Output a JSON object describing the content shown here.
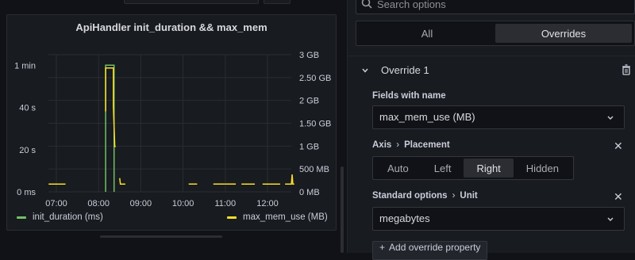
{
  "panel": {
    "title": "ApiHandler init_duration && max_mem",
    "legend": [
      {
        "label": "init_duration (ms)",
        "color": "#73bf69"
      },
      {
        "label": "max_mem_use (MB)",
        "color": "#fade2a"
      }
    ]
  },
  "chart_data": {
    "type": "line",
    "title": "ApiHandler init_duration && max_mem",
    "x_ticks": [
      "07:00",
      "08:00",
      "09:00",
      "10:00",
      "11:00",
      "12:00"
    ],
    "y_left_ticks": [
      "0 ms",
      "20 s",
      "40 s",
      "1 min"
    ],
    "y_left_range_seconds": [
      0,
      65
    ],
    "y_right_ticks": [
      "0 MB",
      "500 MB",
      "1 GB",
      "1.50 GB",
      "2 GB",
      "2.50 GB",
      "3 GB"
    ],
    "y_right_range_MB": [
      0,
      3000
    ],
    "grid": true,
    "legend_placement": "bottom",
    "series": [
      {
        "name": "init_duration (ms)",
        "axis": "left",
        "color": "#73bf69",
        "points": [
          [
            "08:10",
            0
          ],
          [
            "08:10",
            60
          ],
          [
            "08:22",
            60
          ],
          [
            "08:22",
            0
          ]
        ]
      },
      {
        "name": "max_mem_use (MB)",
        "axis": "right",
        "color": "#fade2a",
        "segments": [
          [
            [
              "06:49",
              170
            ],
            [
              "07:13",
              170
            ]
          ],
          [
            [
              "08:10",
              1760
            ],
            [
              "08:10",
              2710
            ],
            [
              "08:21",
              2710
            ],
            [
              "08:21",
              1880
            ],
            [
              "08:23",
              1000
            ],
            [
              "08:24",
              980
            ]
          ],
          [
            [
              "08:30",
              300
            ],
            [
              "08:31",
              170
            ],
            [
              "08:38",
              170
            ]
          ],
          [
            [
              "10:08",
              170
            ],
            [
              "10:20",
              170
            ]
          ],
          [
            [
              "10:43",
              170
            ],
            [
              "11:00",
              170
            ]
          ],
          [
            [
              "11:00",
              170
            ],
            [
              "11:15",
              170
            ]
          ],
          [
            [
              "11:23",
              170
            ],
            [
              "11:42",
              170
            ]
          ],
          [
            [
              "11:53",
              170
            ],
            [
              "12:18",
              170
            ]
          ],
          [
            [
              "12:25",
              170
            ],
            [
              "12:34",
              170
            ],
            [
              "12:35",
              380
            ],
            [
              "12:36",
              170
            ],
            [
              "12:38",
              170
            ]
          ]
        ]
      }
    ]
  },
  "options": {
    "search_placeholder": "Search options",
    "tabs": [
      {
        "label": "All",
        "active": false
      },
      {
        "label": "Overrides",
        "active": true
      }
    ],
    "override": {
      "title": "Override 1",
      "fields_label": "Fields with name",
      "fields_value": "max_mem_use (MB)",
      "axis_label_a": "Axis",
      "axis_label_b": "Placement",
      "placement_options": [
        {
          "label": "Auto",
          "active": false
        },
        {
          "label": "Left",
          "active": false
        },
        {
          "label": "Right",
          "active": true
        },
        {
          "label": "Hidden",
          "active": false
        }
      ],
      "std_label_a": "Standard options",
      "std_label_b": "Unit",
      "unit_value": "megabytes",
      "add_property_label": "Add override property"
    },
    "close_glyph": "✕",
    "arrow_glyph": "›"
  },
  "icons": [
    "search-icon",
    "chevron-down-icon",
    "trash-icon",
    "close-icon",
    "plus-icon"
  ]
}
